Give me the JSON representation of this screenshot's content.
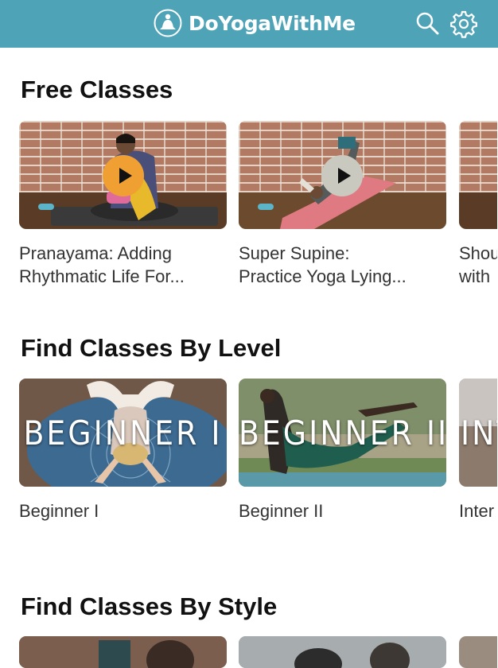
{
  "app": {
    "brand_name": "DoYogaWithMe"
  },
  "header": {
    "search_icon": "search-icon",
    "settings_icon": "gear-icon",
    "background_color": "#4ea3b7"
  },
  "sections": {
    "free_classes": {
      "title": "Free Classes",
      "cards": [
        {
          "title": "Pranayama: Adding\nRhythmatic Life For..."
        },
        {
          "title": "Super Supine:\nPractice Yoga Lying..."
        },
        {
          "title": "Shou\nwith"
        }
      ]
    },
    "by_level": {
      "title": "Find Classes By Level",
      "cards": [
        {
          "overlay": "BEGINNER I",
          "title": "Beginner I"
        },
        {
          "overlay": "BEGINNER II",
          "title": "Beginner II"
        },
        {
          "overlay": "INT",
          "title": "Inter"
        }
      ]
    },
    "by_style": {
      "title": "Find Classes By Style"
    }
  },
  "colors": {
    "play_button_orange": "#f0a032",
    "play_button_gray": "#c9c9c0",
    "progress_pill": "#5bb4c8"
  }
}
